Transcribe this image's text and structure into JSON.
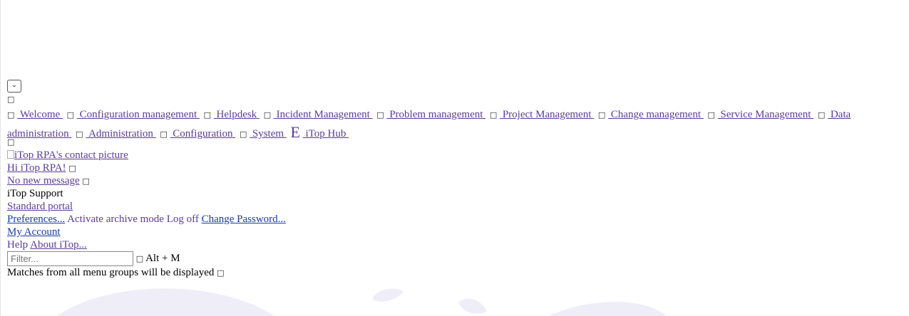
{
  "menu_groups": [
    {
      "label": "Welcome"
    },
    {
      "label": "Configuration management"
    },
    {
      "label": "Helpdesk"
    },
    {
      "label": "Incident Management"
    },
    {
      "label": "Problem management"
    },
    {
      "label": "Project Management"
    },
    {
      "label": "Change management"
    },
    {
      "label": "Service Management"
    },
    {
      "label": "Data administration"
    },
    {
      "label": "Administration"
    },
    {
      "label": "Configuration"
    },
    {
      "label": "System"
    },
    {
      "label": "iTop Hub",
      "icon_glyph": "E"
    }
  ],
  "icons": {
    "placeholder_glyph": "□",
    "chevron_glyph": "⌄"
  },
  "user": {
    "contact_picture_alt": "iTop RPA's contact picture",
    "greeting": "Hi iTop RPA!",
    "messages": "No new message",
    "organization": "iTop Support",
    "portal_link": "Standard portal",
    "preferences": "Preferences...",
    "archive_mode": "Activate archive mode",
    "log_off": "Log off",
    "change_password": "Change Password...",
    "my_account": "My Account",
    "help": "Help",
    "about": "About iTop..."
  },
  "filter": {
    "placeholder": "Filter...",
    "shortcut": "Alt + M",
    "hint": "Matches from all menu groups will be displayed"
  },
  "colors": {
    "link": "#5a3c96",
    "link_blue": "#1a3aa8",
    "background_shape": "#eeedf8"
  }
}
